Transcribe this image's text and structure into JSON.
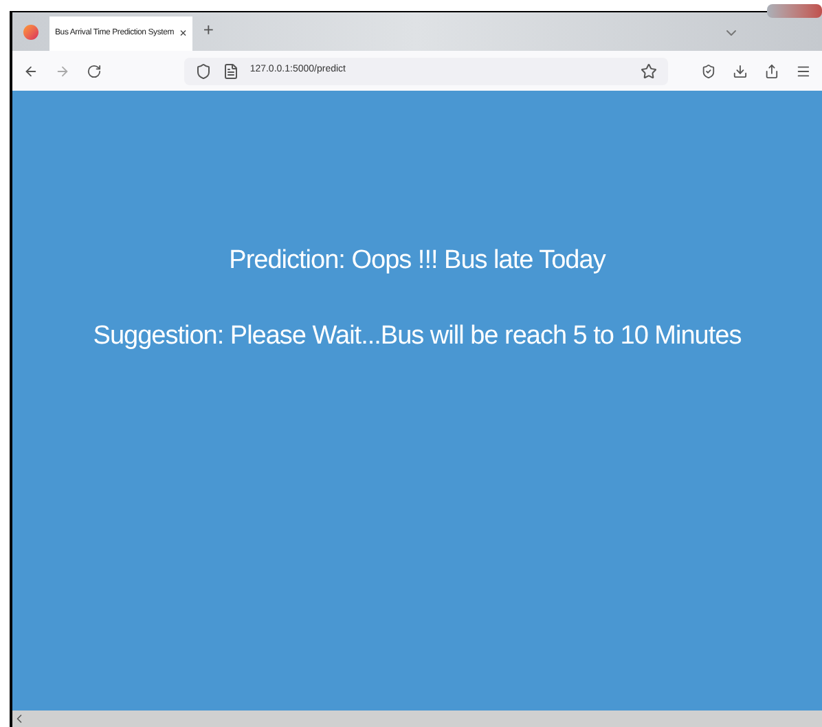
{
  "tab": {
    "title": "Bus Arrival Time Prediction System",
    "close": "×",
    "new_tab": "+"
  },
  "address_bar": {
    "url": "127.0.0.1:5000/predict"
  },
  "content": {
    "lines": [
      "Prediction: Oops !!! Bus late Today",
      "Suggestion: Please Wait...Bus will be reach 5 to 10 Minutes"
    ]
  }
}
